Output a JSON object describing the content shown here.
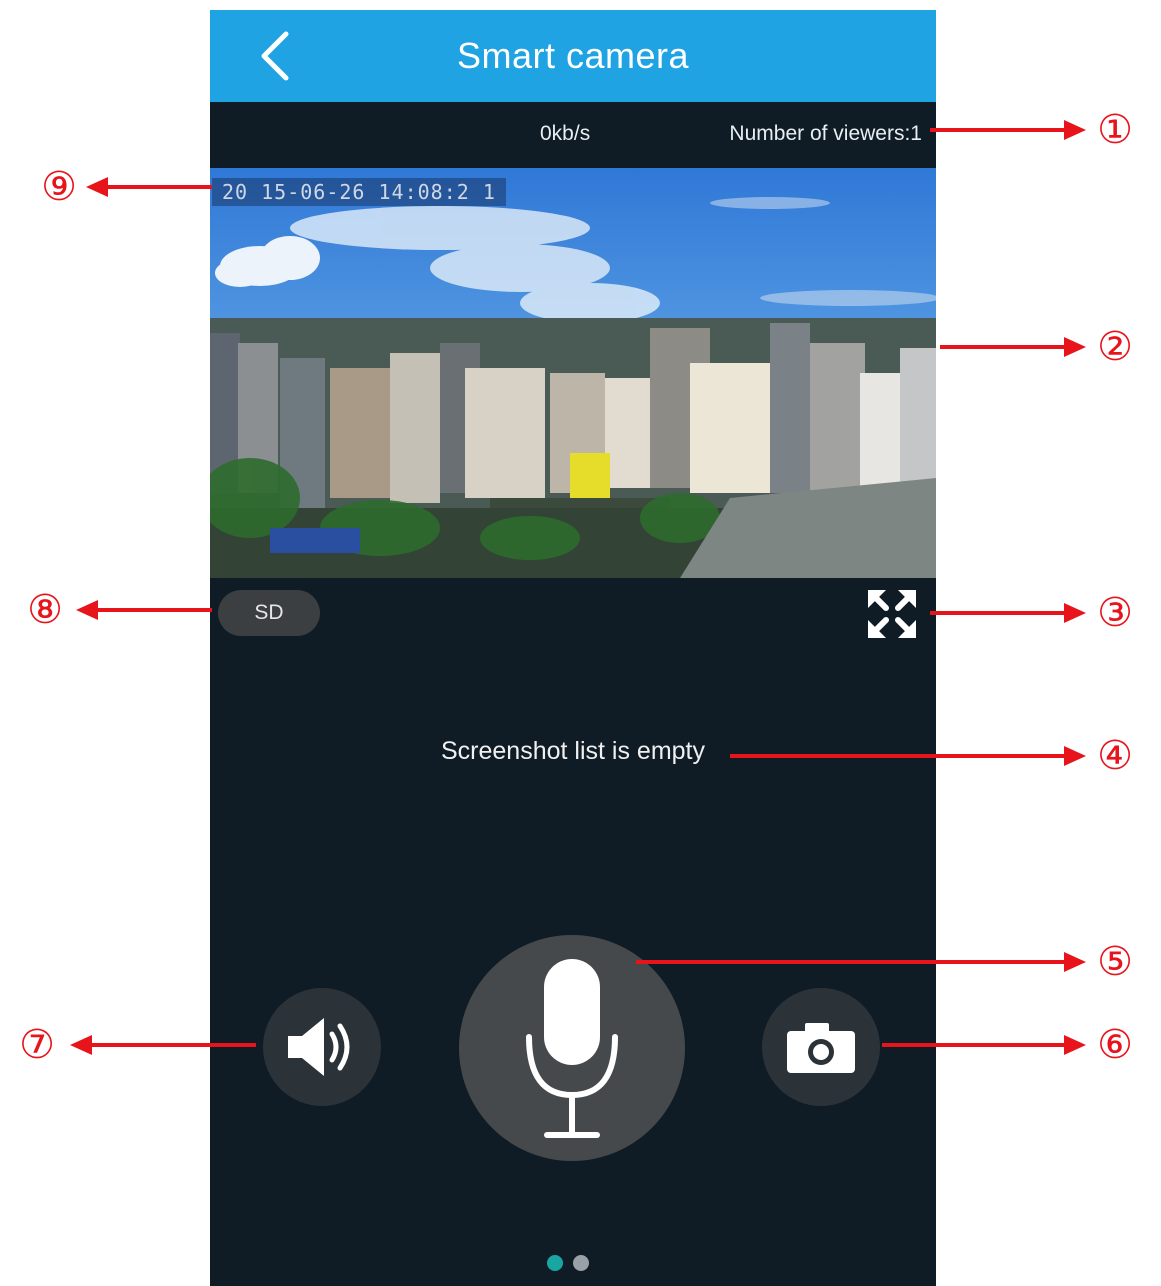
{
  "header": {
    "title": "Smart camera"
  },
  "status": {
    "rate": "0kb/s",
    "viewers": "Number of viewers:1"
  },
  "video": {
    "timestamp": "20 15-06-26   14:08:2 1"
  },
  "controls": {
    "quality": "SD"
  },
  "screenshots": {
    "empty_text": "Screenshot list is empty"
  },
  "pager": {
    "pages": 2,
    "active": 1
  },
  "callouts": [
    "①",
    "②",
    "③",
    "④",
    "⑤",
    "⑥",
    "⑦",
    "⑧",
    "⑨"
  ],
  "colors": {
    "header": "#1fa3e3",
    "background": "#0f1c25",
    "callout": "#e8141c",
    "pager_active": "#1aa6a0"
  }
}
